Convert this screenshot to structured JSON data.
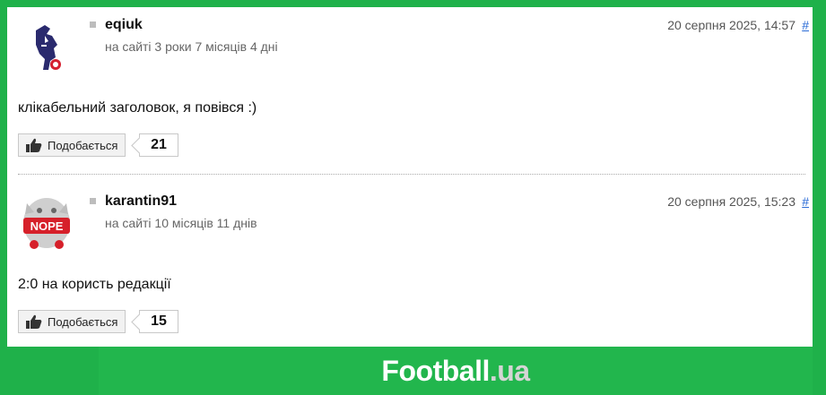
{
  "comments": [
    {
      "username": "eqiuk",
      "since": "на сайті 3 роки 7 місяців 4 дні",
      "date": "20 серпня 2025, 14:57",
      "permalink": "#",
      "text": "клікабельний заголовок, я повівся :)",
      "like_label": "Подобається",
      "likes": "21"
    },
    {
      "username": "karantin91",
      "since": "на сайті 10 місяців 11 днів",
      "date": "20 серпня 2025, 15:23",
      "permalink": "#",
      "text": "2:0 на користь редакції",
      "like_label": "Подобається",
      "likes": "15",
      "avatar_text": "NOPE"
    }
  ],
  "footer": {
    "logo_main": "Football",
    "logo_suffix": ".ua"
  },
  "colors": {
    "brand_green": "#1fb14a",
    "link_blue": "#2a6bd6"
  }
}
